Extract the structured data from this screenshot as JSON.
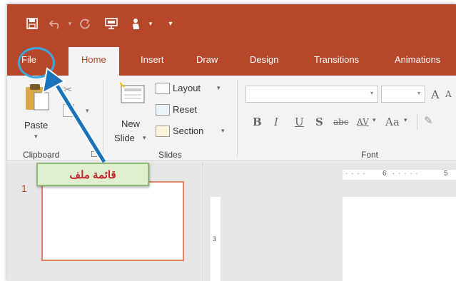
{
  "tabs": {
    "file": "File",
    "home": "Home",
    "insert": "Insert",
    "draw": "Draw",
    "design": "Design",
    "transitions": "Transitions",
    "animations": "Animations"
  },
  "clipboard": {
    "paste_label": "Paste",
    "group_label": "Clipboard"
  },
  "slides": {
    "new_slide_line1": "New",
    "new_slide_line2": "Slide",
    "layout_label": "Layout",
    "reset_label": "Reset",
    "section_label": "Section",
    "group_label": "Slides"
  },
  "font": {
    "bold": "B",
    "italic": "I",
    "underline": "U",
    "shadow": "S",
    "strike": "abc",
    "spacing": "AV",
    "case": "Aa",
    "grow": "A",
    "group_label": "Font"
  },
  "thumbnail": {
    "slide_number": "1"
  },
  "ruler": {
    "left_mark": "6",
    "right_mark": "5",
    "vertical_mark": "3"
  },
  "annotation": {
    "label": "قائمة ملف"
  },
  "colors": {
    "brand": "#b7472a",
    "callout_text": "#c0262d",
    "callout_bg": "#e0efd0",
    "highlight_circle": "#3ba7dd",
    "arrow": "#1a73b8"
  },
  "icons": {
    "save": "save-icon",
    "undo": "undo-icon",
    "redo": "redo-icon",
    "present": "present-icon",
    "touch": "touch-mode-icon",
    "customize": "customize-qat-icon"
  }
}
